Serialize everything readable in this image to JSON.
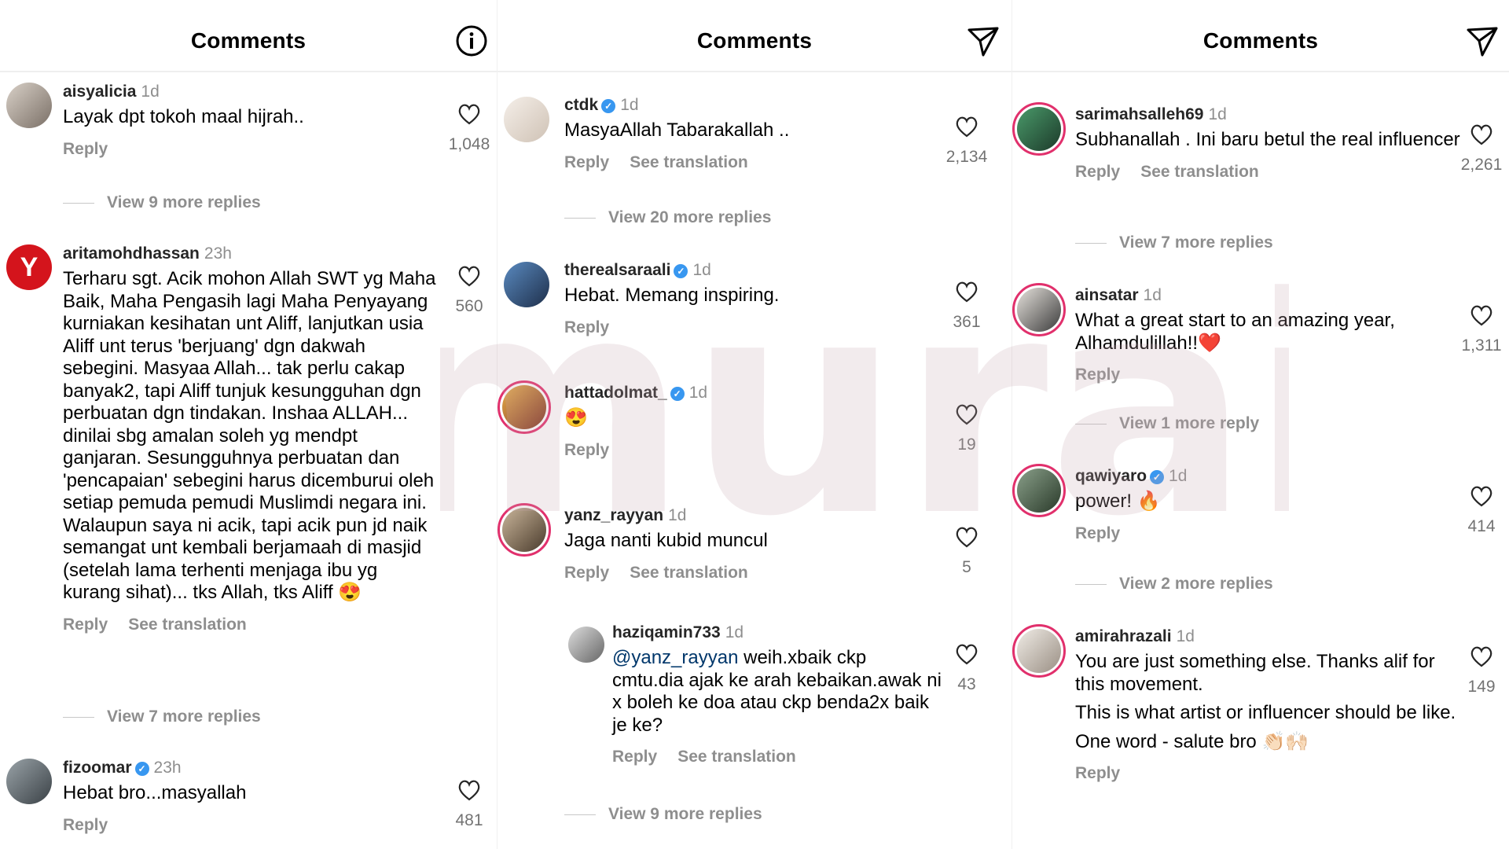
{
  "panels": [
    {
      "title": "Comments",
      "header_icon": "info-icon",
      "comments": [
        {
          "user": "aisyalicia",
          "time": "1d",
          "verified": false,
          "text": "Layak dpt tokoh maal hijrah..",
          "reply": "Reply",
          "likes": "1,048",
          "view_more": "View 9 more replies"
        },
        {
          "user": "aritamohdhassan",
          "time": "23h",
          "verified": false,
          "text": "Terharu sgt. Acik mohon Allah SWT yg Maha Baik, Maha Pengasih lagi Maha Penyayang kurniakan kesihatan unt Aliff, lanjutkan usia Aliff unt terus 'berjuang' dgn dakwah sebegini. Masyaa Allah... tak perlu cakap banyak2, tapi Aliff tunjuk kesungguhan dgn perbuatan dgn tindakan. Inshaa ALLAH... dinilai sbg amalan soleh yg mendpt ganjaran. Sesungguhnya perbuatan dan 'pencapaian' sebegini harus dicemburui oleh setiap pemuda pemudi Muslimdi negara ini. Walaupun saya ni acik, tapi acik pun jd naik semangat unt kembali berjamaah di masjid (setelah lama terhenti menjaga ibu yg kurang sihat)... tks Allah, tks Aliff 😍",
          "reply": "Reply",
          "see_translation": "See translation",
          "likes": "560",
          "view_more": "View 7 more replies"
        },
        {
          "user": "fizoomar",
          "time": "23h",
          "verified": true,
          "text": "Hebat bro...masyallah",
          "reply": "Reply",
          "likes": "481"
        }
      ]
    },
    {
      "title": "Comments",
      "header_icon": "send-icon",
      "comments": [
        {
          "user": "ctdk",
          "time": "1d",
          "verified": true,
          "text": "MasyaAllah Tabarakallah ..",
          "reply": "Reply",
          "see_translation": "See translation",
          "likes": "2,134",
          "view_more": "View 20 more replies"
        },
        {
          "user": "therealsaraali",
          "time": "1d",
          "verified": true,
          "text": "Hebat. Memang inspiring.",
          "reply": "Reply",
          "likes": "361"
        },
        {
          "user": "hattadolmat_",
          "time": "1d",
          "verified": true,
          "text": "😍",
          "reply": "Reply",
          "likes": "19"
        },
        {
          "user": "yanz_rayyan",
          "time": "1d",
          "verified": false,
          "text": "Jaga nanti kubid muncul",
          "reply": "Reply",
          "see_translation": "See translation",
          "likes": "5"
        },
        {
          "user": "haziqamin733",
          "time": "1d",
          "verified": false,
          "mention": "@yanz_rayyan",
          "text": " weih.xbaik ckp cmtu.dia ajak ke arah kebaikan.awak ni x boleh ke doa atau ckp benda2x baik je ke?",
          "reply": "Reply",
          "see_translation": "See translation",
          "likes": "43",
          "view_more": "View 9 more replies"
        }
      ]
    },
    {
      "title": "Comments",
      "header_icon": "send-icon",
      "comments": [
        {
          "user": "sarimahsalleh69",
          "time": "1d",
          "verified": false,
          "text": "Subhanallah . Ini baru betul the real influencer",
          "reply": "Reply",
          "see_translation": "See translation",
          "likes": "2,261",
          "view_more": "View 7 more replies"
        },
        {
          "user": "ainsatar",
          "time": "1d",
          "verified": false,
          "text": "What a great start to an amazing year, Alhamdulillah!!❤️",
          "reply": "Reply",
          "likes": "1,311",
          "view_more": "View 1 more reply"
        },
        {
          "user": "qawiyaro",
          "time": "1d",
          "verified": true,
          "text": "power! 🔥",
          "reply": "Reply",
          "likes": "414",
          "view_more": "View 2 more replies"
        },
        {
          "user": "amirahrazali",
          "time": "1d",
          "verified": false,
          "text": "You are just something else. Thanks alif for this movement.",
          "text2": "This is what artist or influencer should be like.",
          "text3": "One word - salute bro 👏🏻🙌🏻",
          "reply": "Reply",
          "likes": "149"
        }
      ]
    }
  ],
  "watermark": "murai",
  "colors": {
    "accent_pink": "#e1306c",
    "verified_blue": "#3897f0",
    "muted_gray": "#8e8e8e",
    "watermark": "#c8a8b0"
  }
}
